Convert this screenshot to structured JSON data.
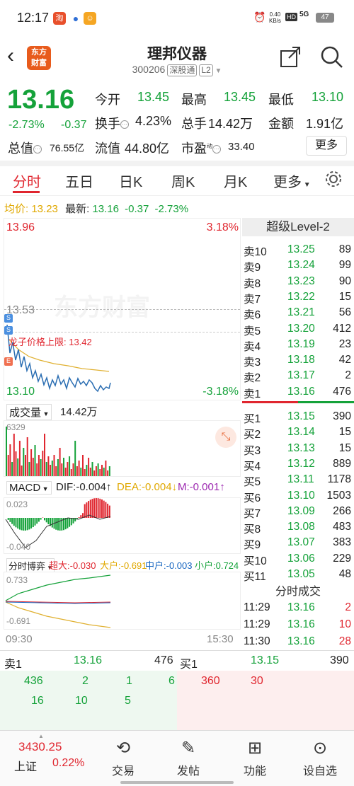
{
  "statusbar": {
    "time": "12:17",
    "net_speed_top": "0.40",
    "net_speed_bot": "KB/s",
    "hd": "HD",
    "signal": "5G",
    "battery": "47"
  },
  "header": {
    "title": "理邦仪器",
    "code": "300206",
    "tag1": "深股通",
    "tag2": "L2",
    "logo_line1": "东方",
    "logo_line2": "财富"
  },
  "quote": {
    "price": "13.16",
    "change_pct": "-2.73%",
    "change": "-0.37",
    "open_label": "今开",
    "open": "13.45",
    "high_label": "最高",
    "high": "13.45",
    "low_label": "最低",
    "low": "13.10",
    "turnover_label": "换手",
    "turnover": "4.23%",
    "volume_label": "总手",
    "volume": "14.42万",
    "amount_label": "金额",
    "amount": "1.91亿",
    "mcap_label": "总值",
    "mcap": "76.55亿",
    "float_label": "流值",
    "float": "44.80亿",
    "pe_label": "市盈",
    "pe_sup": "动",
    "pe": "33.40",
    "more": "更多"
  },
  "tabs": [
    "分时",
    "五日",
    "日K",
    "周K",
    "月K",
    "更多"
  ],
  "chart": {
    "avg_label": "均价:",
    "avg": "13.23",
    "last_label": "最新:",
    "last": "13.16",
    "chg": "-0.37",
    "chg_pct": "-2.73%",
    "top_price": "13.96",
    "top_pct": "3.18%",
    "mid_price": "13.53",
    "bottom_price": "13.10",
    "bottom_pct": "-3.18%",
    "limit_text": "龙子价格上限: 13.42",
    "watermark": "东方财富",
    "vol_label": "成交量",
    "vol_value": "14.42万",
    "vol_max": "6329",
    "macd_label": "MACD",
    "dif": "DIF:-0.004↑",
    "dea": "DEA:-0.004↓",
    "m": "M:-0.001↑",
    "macd_top": "0.023",
    "macd_bot": "-0.040",
    "game_label": "分时博弈",
    "super": "超大:-0.030",
    "large": "大户:-0.691",
    "mid": "中户:-0.003",
    "small": "小户:0.724",
    "game_top": "0.733",
    "game_bot": "-0.691",
    "time_start": "09:30",
    "time_end": "15:30"
  },
  "orderbook": {
    "title": "超级Level-2",
    "sells": [
      {
        "label": "卖10",
        "price": "13.25",
        "vol": "89"
      },
      {
        "label": "卖9",
        "price": "13.24",
        "vol": "99"
      },
      {
        "label": "卖8",
        "price": "13.23",
        "vol": "90"
      },
      {
        "label": "卖7",
        "price": "13.22",
        "vol": "15"
      },
      {
        "label": "卖6",
        "price": "13.21",
        "vol": "56"
      },
      {
        "label": "卖5",
        "price": "13.20",
        "vol": "412"
      },
      {
        "label": "卖4",
        "price": "13.19",
        "vol": "23"
      },
      {
        "label": "卖3",
        "price": "13.18",
        "vol": "42"
      },
      {
        "label": "卖2",
        "price": "13.17",
        "vol": "2"
      },
      {
        "label": "卖1",
        "price": "13.16",
        "vol": "476"
      }
    ],
    "buys": [
      {
        "label": "买1",
        "price": "13.15",
        "vol": "390"
      },
      {
        "label": "买2",
        "price": "13.14",
        "vol": "15"
      },
      {
        "label": "买3",
        "price": "13.13",
        "vol": "15"
      },
      {
        "label": "买4",
        "price": "13.12",
        "vol": "889"
      },
      {
        "label": "买5",
        "price": "13.11",
        "vol": "1178"
      },
      {
        "label": "买6",
        "price": "13.10",
        "vol": "1503"
      },
      {
        "label": "买7",
        "price": "13.09",
        "vol": "266"
      },
      {
        "label": "买8",
        "price": "13.08",
        "vol": "483"
      },
      {
        "label": "买9",
        "price": "13.07",
        "vol": "383"
      },
      {
        "label": "买10",
        "price": "13.06",
        "vol": "229"
      },
      {
        "label": "买11",
        "price": "13.05",
        "vol": "48"
      }
    ],
    "trades_title": "分时成交",
    "trades": [
      {
        "time": "11:29",
        "price": "13.16",
        "vol": "2"
      },
      {
        "time": "11:29",
        "price": "13.16",
        "vol": "10"
      },
      {
        "time": "11:30",
        "price": "13.16",
        "vol": "28"
      }
    ]
  },
  "level1": {
    "sell_label": "卖1",
    "sell_price": "13.16",
    "sell_vol": "476",
    "buy_label": "买1",
    "buy_price": "13.15",
    "buy_vol": "390",
    "sell_q_row1": [
      "436",
      "2",
      "1",
      "6"
    ],
    "sell_q_row2": [
      "16",
      "10",
      "5"
    ],
    "buy_q_row1": [
      "360",
      "30"
    ]
  },
  "footer": {
    "index_value": "3430.25",
    "index_name": "上证",
    "index_pct": "0.22%",
    "nav": [
      {
        "label": "交易",
        "icon": "trade-icon"
      },
      {
        "label": "发帖",
        "icon": "post-icon"
      },
      {
        "label": "功能",
        "icon": "grid-icon"
      },
      {
        "label": "设自选",
        "icon": "more-icon"
      }
    ]
  }
}
